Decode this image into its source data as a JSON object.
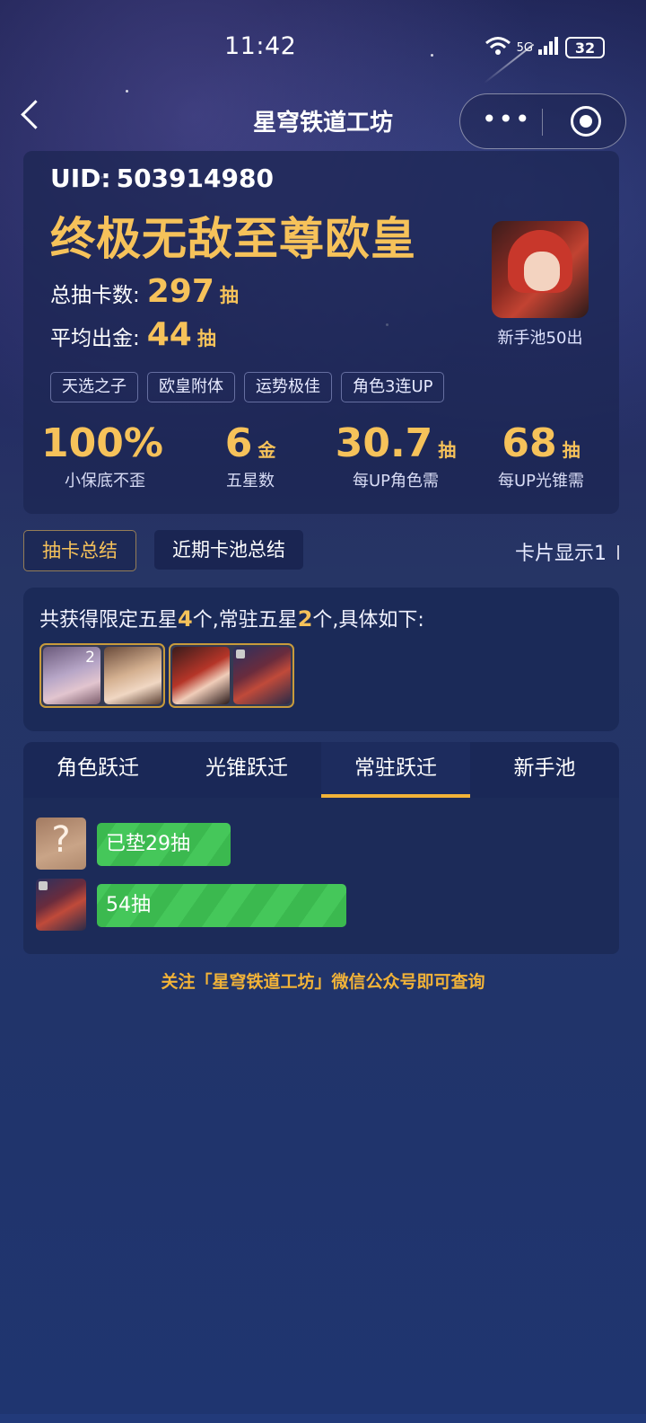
{
  "status_bar": {
    "time": "11:42",
    "signal_label": "5G",
    "battery": "32"
  },
  "nav": {
    "title": "星穹铁道工坊",
    "more_icon": "more-dots-icon",
    "close_icon": "target-icon"
  },
  "profile": {
    "uid_label": "UID:",
    "uid": "503914980",
    "rank_title": "终极无敌至尊欧皇",
    "total_pulls_label": "总抽卡数:",
    "total_pulls": "297",
    "total_pulls_unit": "抽",
    "avg_gold_label": "平均出金:",
    "avg_gold": "44",
    "avg_gold_unit": "抽",
    "portrait_caption": "新手池50出",
    "tags": [
      "天选之子",
      "欧皇附体",
      "运势极佳",
      "角色3连UP"
    ],
    "metrics": [
      {
        "value": "100%",
        "unit": "",
        "label": "小保底不歪"
      },
      {
        "value": "6",
        "unit": "金",
        "label": "五星数"
      },
      {
        "value": "30.7",
        "unit": "抽",
        "label": "每UP角色需"
      },
      {
        "value": "68",
        "unit": "抽",
        "label": "每UP光锥需"
      }
    ]
  },
  "section_tabs": {
    "summary": "抽卡总结",
    "recent": "近期卡池总结",
    "card_display": "卡片显示1"
  },
  "summary": {
    "prefix": "共获得限定五星",
    "limited_count": "4",
    "middle": "个,常驻五星",
    "standard_count": "2",
    "suffix": "个,具体如下:",
    "thumb_count_badge": "2"
  },
  "pool_tabs": [
    "角色跃迁",
    "光锥跃迁",
    "常驻跃迁",
    "新手池"
  ],
  "pity_rows": [
    {
      "icon": "question-icon",
      "glyph": "?",
      "label": "已垫29抽",
      "pulls": 29
    },
    {
      "icon": "character-thumb",
      "glyph": "",
      "label": "54抽",
      "pulls": 54
    }
  ],
  "footer": "关注「星穹铁道工坊」微信公众号即可查询",
  "colors": {
    "accent_gold": "#f6c25a",
    "bar_green": "#3bb94f",
    "tab_underline": "#f2b338"
  }
}
